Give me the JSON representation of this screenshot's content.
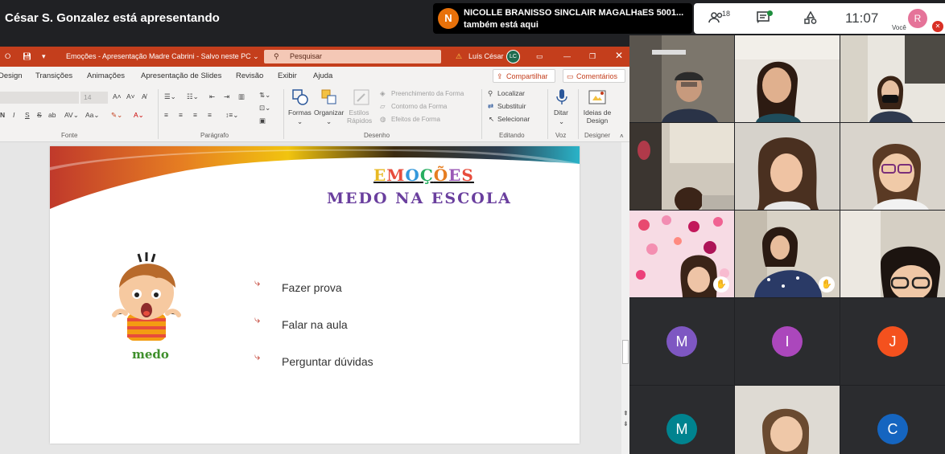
{
  "meet": {
    "presenter_banner": "César S. Gonzalez está apresentando",
    "notification": {
      "avatar_letter": "N",
      "name": "NICOLLE BRANISSO SINCLAIR MAGALHaES 5001...",
      "message": "também está aqui"
    },
    "participants_count": "18",
    "clock": "11:07",
    "self_avatar_letter": "R",
    "self_label": "Você",
    "colors": {
      "notify_avatar": "#e8710a",
      "self_avatar": "#e57399",
      "chat_dot": "#1e8e3e",
      "mic_off": "#d93025"
    }
  },
  "powerpoint": {
    "window_title": "Emoções - Apresentação Madre Cabrini  -  Salvo neste PC  ⌄",
    "search_placeholder": "Pesquisar",
    "user_name": "Luís César",
    "user_initials": "LC",
    "tabs": [
      "Design",
      "Transições",
      "Animações",
      "Apresentação de Slides",
      "Revisão",
      "Exibir",
      "Ajuda"
    ],
    "share_label": "Compartilhar",
    "comments_label": "Comentários",
    "ribbon": {
      "font_size": "14",
      "group_labels": [
        "Fonte",
        "Parágrafo",
        "Desenho",
        "Editando",
        "Voz",
        "Designer"
      ],
      "shapes_label": "Formas",
      "arrange_label": "Organizar",
      "quick_styles_label": "Estilos Rápidos",
      "fill_label": "Preenchimento da Forma",
      "outline_label": "Contorno da Forma",
      "effects_label": "Efeitos de Forma",
      "find_label": "Localizar",
      "replace_label": "Substituir",
      "select_label": "Selecionar",
      "dictate_label": "Ditar",
      "design_ideas_label": "Ideias de Design"
    },
    "slide": {
      "title": "EMOÇÕES",
      "subtitle": "MEDO NA ESCOLA",
      "image_caption": "medo",
      "bullets": [
        "Fazer prova",
        "Falar na aula",
        "Perguntar dúvidas"
      ],
      "title_letter_colors": [
        "#e8b923",
        "#e74c3c",
        "#3498db",
        "#27ae60",
        "#e67e22",
        "#9b59b6",
        "#e74c3c"
      ]
    },
    "colors": {
      "title_bar": "#c43e1c",
      "subtitle": "#6a3f9e",
      "caption": "#3e8f2b"
    }
  },
  "tiles": {
    "avatars": [
      {
        "letter": "M",
        "color": "#7e57c2"
      },
      {
        "letter": "I",
        "color": "#ab47bc"
      },
      {
        "letter": "J",
        "color": "#f4511e"
      },
      {
        "letter": "M",
        "color": "#00838f"
      },
      {
        "letter": "C",
        "color": "#1565c0"
      }
    ]
  }
}
